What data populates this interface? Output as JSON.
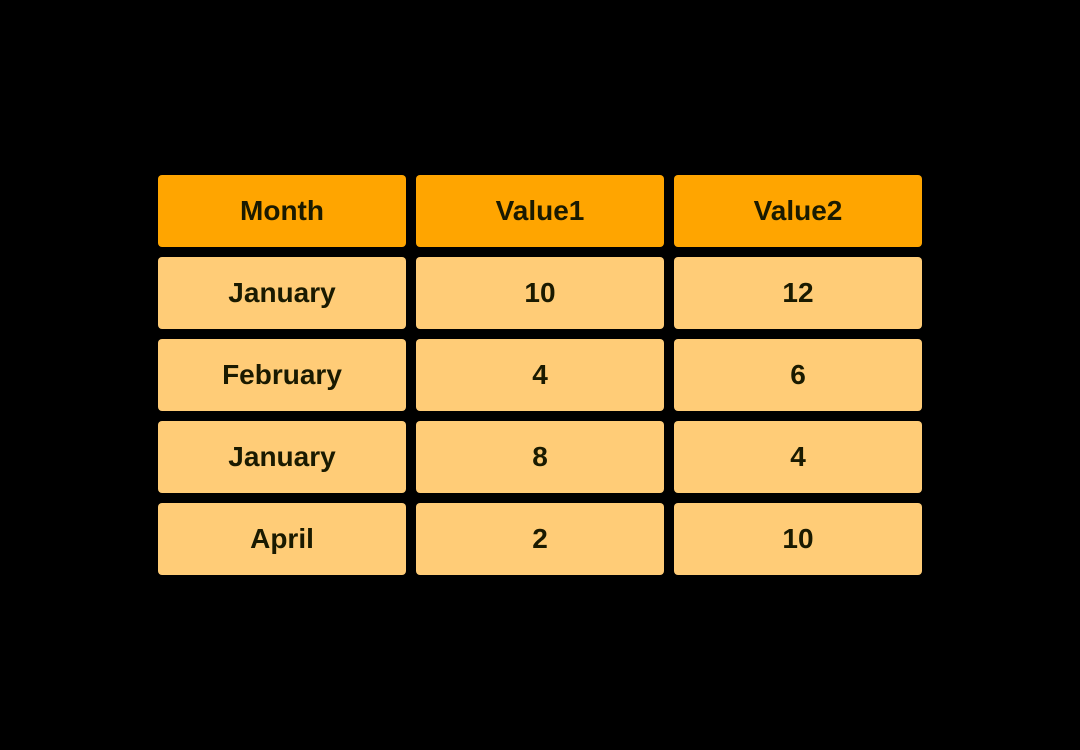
{
  "table": {
    "headers": [
      {
        "id": "month",
        "label": "Month"
      },
      {
        "id": "value1",
        "label": "Value1"
      },
      {
        "id": "value2",
        "label": "Value2"
      }
    ],
    "rows": [
      {
        "month": "January",
        "value1": "10",
        "value2": "12"
      },
      {
        "month": "February",
        "value1": "4",
        "value2": "6"
      },
      {
        "month": "January",
        "value1": "8",
        "value2": "4"
      },
      {
        "month": "April",
        "value1": "2",
        "value2": "10"
      }
    ]
  }
}
